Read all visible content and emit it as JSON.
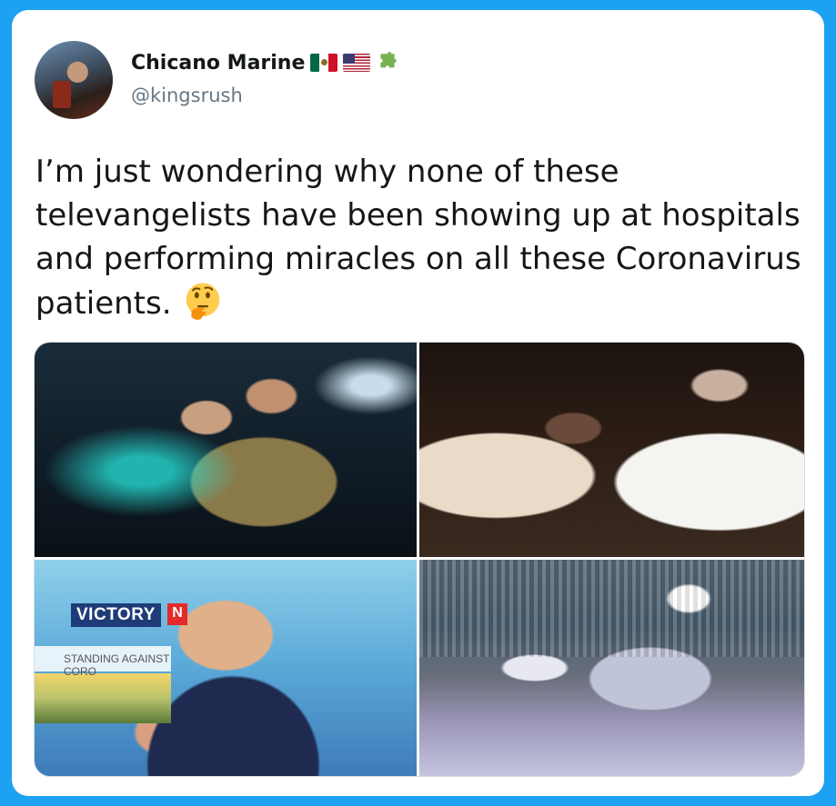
{
  "tweet": {
    "author_name": "Chicano Marine",
    "author_handle": "@kingsrush",
    "name_emojis": [
      "mexico-flag",
      "us-flag",
      "puzzle-piece"
    ],
    "text": "I’m just wondering why none of these televangelists have been showing up at hospitals and performing miracles on all these Coronavirus patients.",
    "text_emoji": "thinking-face"
  },
  "media": {
    "photos": [
      {
        "name": "photo-1"
      },
      {
        "name": "photo-2"
      },
      {
        "name": "photo-3",
        "overlay_title": "VICTORY",
        "overlay_accent": "N",
        "overlay_subtitle": "STANDING AGAINST CORO"
      },
      {
        "name": "photo-4"
      }
    ]
  },
  "colors": {
    "background": "#1da1f2",
    "card": "#ffffff",
    "text": "#14171a",
    "handle": "#657786"
  }
}
